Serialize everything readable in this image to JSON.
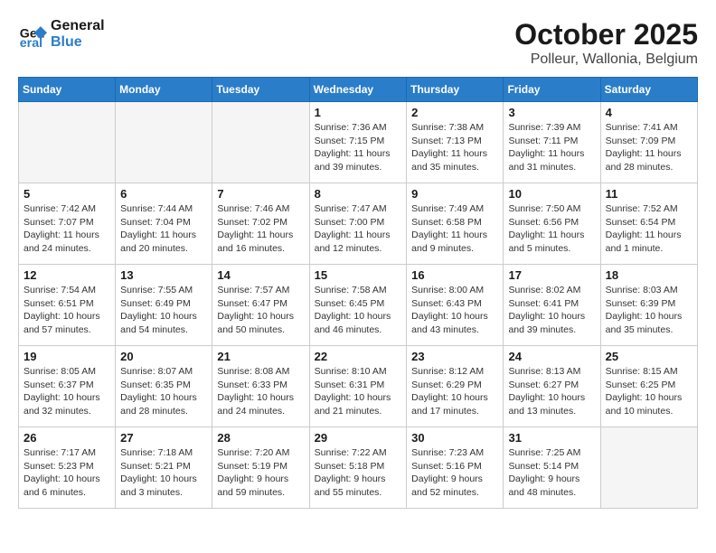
{
  "logo": {
    "line1": "General",
    "line2": "Blue"
  },
  "title": "October 2025",
  "location": "Polleur, Wallonia, Belgium",
  "weekdays": [
    "Sunday",
    "Monday",
    "Tuesday",
    "Wednesday",
    "Thursday",
    "Friday",
    "Saturday"
  ],
  "weeks": [
    [
      {
        "day": "",
        "info": ""
      },
      {
        "day": "",
        "info": ""
      },
      {
        "day": "",
        "info": ""
      },
      {
        "day": "1",
        "info": "Sunrise: 7:36 AM\nSunset: 7:15 PM\nDaylight: 11 hours\nand 39 minutes."
      },
      {
        "day": "2",
        "info": "Sunrise: 7:38 AM\nSunset: 7:13 PM\nDaylight: 11 hours\nand 35 minutes."
      },
      {
        "day": "3",
        "info": "Sunrise: 7:39 AM\nSunset: 7:11 PM\nDaylight: 11 hours\nand 31 minutes."
      },
      {
        "day": "4",
        "info": "Sunrise: 7:41 AM\nSunset: 7:09 PM\nDaylight: 11 hours\nand 28 minutes."
      }
    ],
    [
      {
        "day": "5",
        "info": "Sunrise: 7:42 AM\nSunset: 7:07 PM\nDaylight: 11 hours\nand 24 minutes."
      },
      {
        "day": "6",
        "info": "Sunrise: 7:44 AM\nSunset: 7:04 PM\nDaylight: 11 hours\nand 20 minutes."
      },
      {
        "day": "7",
        "info": "Sunrise: 7:46 AM\nSunset: 7:02 PM\nDaylight: 11 hours\nand 16 minutes."
      },
      {
        "day": "8",
        "info": "Sunrise: 7:47 AM\nSunset: 7:00 PM\nDaylight: 11 hours\nand 12 minutes."
      },
      {
        "day": "9",
        "info": "Sunrise: 7:49 AM\nSunset: 6:58 PM\nDaylight: 11 hours\nand 9 minutes."
      },
      {
        "day": "10",
        "info": "Sunrise: 7:50 AM\nSunset: 6:56 PM\nDaylight: 11 hours\nand 5 minutes."
      },
      {
        "day": "11",
        "info": "Sunrise: 7:52 AM\nSunset: 6:54 PM\nDaylight: 11 hours\nand 1 minute."
      }
    ],
    [
      {
        "day": "12",
        "info": "Sunrise: 7:54 AM\nSunset: 6:51 PM\nDaylight: 10 hours\nand 57 minutes."
      },
      {
        "day": "13",
        "info": "Sunrise: 7:55 AM\nSunset: 6:49 PM\nDaylight: 10 hours\nand 54 minutes."
      },
      {
        "day": "14",
        "info": "Sunrise: 7:57 AM\nSunset: 6:47 PM\nDaylight: 10 hours\nand 50 minutes."
      },
      {
        "day": "15",
        "info": "Sunrise: 7:58 AM\nSunset: 6:45 PM\nDaylight: 10 hours\nand 46 minutes."
      },
      {
        "day": "16",
        "info": "Sunrise: 8:00 AM\nSunset: 6:43 PM\nDaylight: 10 hours\nand 43 minutes."
      },
      {
        "day": "17",
        "info": "Sunrise: 8:02 AM\nSunset: 6:41 PM\nDaylight: 10 hours\nand 39 minutes."
      },
      {
        "day": "18",
        "info": "Sunrise: 8:03 AM\nSunset: 6:39 PM\nDaylight: 10 hours\nand 35 minutes."
      }
    ],
    [
      {
        "day": "19",
        "info": "Sunrise: 8:05 AM\nSunset: 6:37 PM\nDaylight: 10 hours\nand 32 minutes."
      },
      {
        "day": "20",
        "info": "Sunrise: 8:07 AM\nSunset: 6:35 PM\nDaylight: 10 hours\nand 28 minutes."
      },
      {
        "day": "21",
        "info": "Sunrise: 8:08 AM\nSunset: 6:33 PM\nDaylight: 10 hours\nand 24 minutes."
      },
      {
        "day": "22",
        "info": "Sunrise: 8:10 AM\nSunset: 6:31 PM\nDaylight: 10 hours\nand 21 minutes."
      },
      {
        "day": "23",
        "info": "Sunrise: 8:12 AM\nSunset: 6:29 PM\nDaylight: 10 hours\nand 17 minutes."
      },
      {
        "day": "24",
        "info": "Sunrise: 8:13 AM\nSunset: 6:27 PM\nDaylight: 10 hours\nand 13 minutes."
      },
      {
        "day": "25",
        "info": "Sunrise: 8:15 AM\nSunset: 6:25 PM\nDaylight: 10 hours\nand 10 minutes."
      }
    ],
    [
      {
        "day": "26",
        "info": "Sunrise: 7:17 AM\nSunset: 5:23 PM\nDaylight: 10 hours\nand 6 minutes."
      },
      {
        "day": "27",
        "info": "Sunrise: 7:18 AM\nSunset: 5:21 PM\nDaylight: 10 hours\nand 3 minutes."
      },
      {
        "day": "28",
        "info": "Sunrise: 7:20 AM\nSunset: 5:19 PM\nDaylight: 9 hours\nand 59 minutes."
      },
      {
        "day": "29",
        "info": "Sunrise: 7:22 AM\nSunset: 5:18 PM\nDaylight: 9 hours\nand 55 minutes."
      },
      {
        "day": "30",
        "info": "Sunrise: 7:23 AM\nSunset: 5:16 PM\nDaylight: 9 hours\nand 52 minutes."
      },
      {
        "day": "31",
        "info": "Sunrise: 7:25 AM\nSunset: 5:14 PM\nDaylight: 9 hours\nand 48 minutes."
      },
      {
        "day": "",
        "info": ""
      }
    ]
  ]
}
